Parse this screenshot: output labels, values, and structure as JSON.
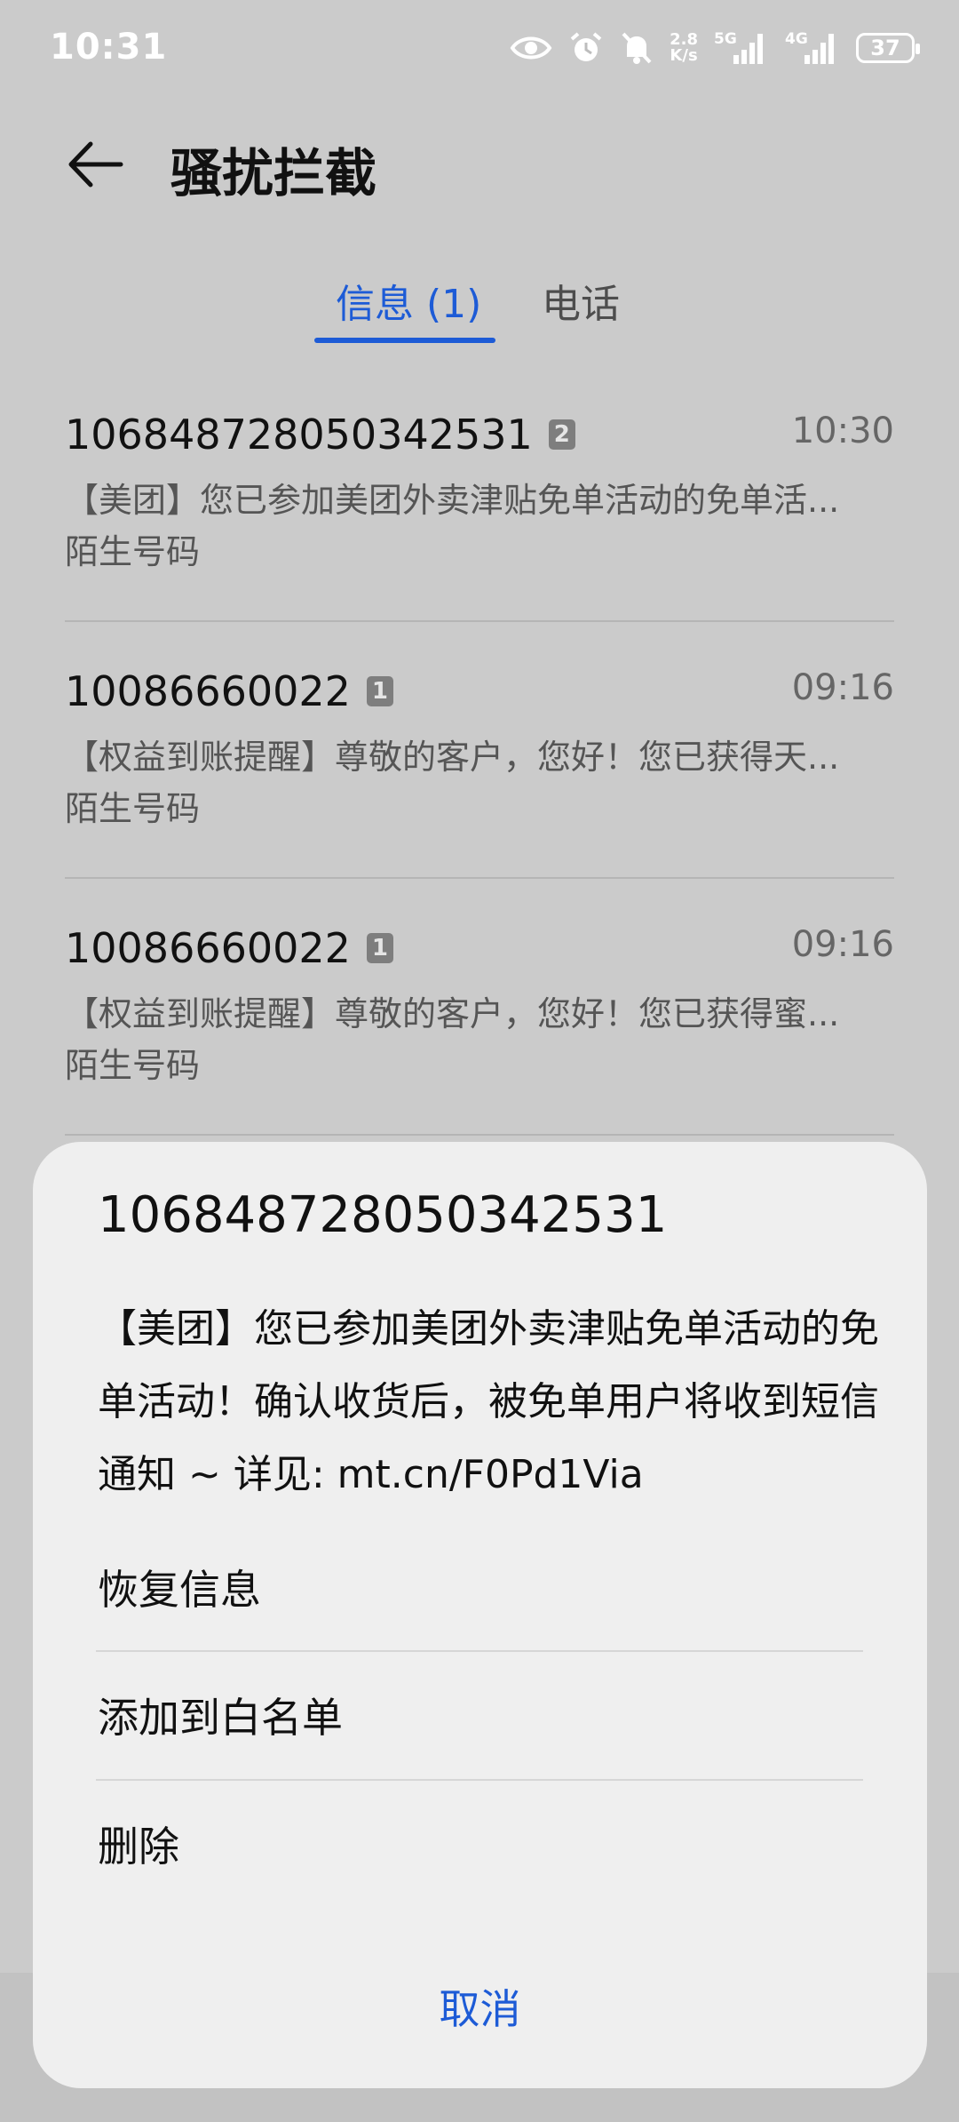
{
  "status_bar": {
    "time": "10:31",
    "net_speed_value": "2.8",
    "net_speed_unit": "K/s",
    "signal1": "5G",
    "signal2": "4G",
    "battery": "37"
  },
  "header": {
    "title": "骚扰拦截"
  },
  "tabs": [
    {
      "label": "信息 (1)",
      "active": true
    },
    {
      "label": "电话",
      "active": false
    }
  ],
  "messages": [
    {
      "number": "106848728050342531",
      "count": "2",
      "time": "10:30",
      "preview": "【美团】您已参加美团外卖津贴免单活动的免单活...",
      "tag": "陌生号码"
    },
    {
      "number": "10086660022",
      "count": "1",
      "time": "09:16",
      "preview": "【权益到账提醒】尊敬的客户，您好！您已获得天...",
      "tag": "陌生号码"
    },
    {
      "number": "10086660022",
      "count": "1",
      "time": "09:16",
      "preview": "【权益到账提醒】尊敬的客户，您好！您已获得蜜...",
      "tag": "陌生号码"
    }
  ],
  "sheet": {
    "title": "106848728050342531",
    "body": "【美团】您已参加美团外卖津贴免单活动的免单活动！确认收货后，被免单用户将收到短信通知 ~ 详见: mt.cn/F0Pd1Via",
    "actions": [
      "恢复信息",
      "添加到白名单",
      "删除"
    ],
    "cancel": "取消"
  },
  "colors": {
    "accent": "#1d5bd6",
    "overlay": "#cbcbcb",
    "sheet": "#efefef"
  },
  "icons": [
    "eye-icon",
    "alarm-icon",
    "bell-off-icon",
    "back-arrow-icon"
  ]
}
